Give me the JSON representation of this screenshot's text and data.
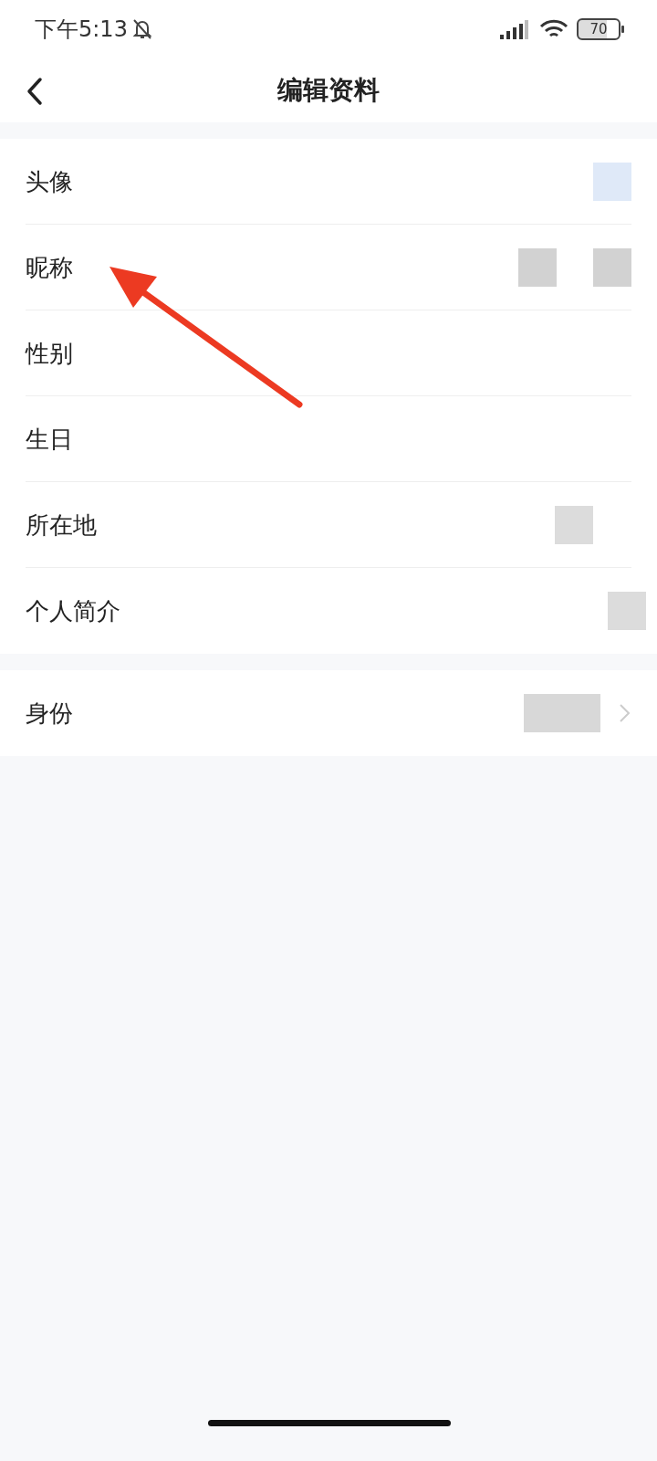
{
  "status_bar": {
    "time": "下午5:13",
    "battery": "70"
  },
  "header": {
    "title": "编辑资料"
  },
  "groups": [
    {
      "rows": [
        {
          "label": "头像",
          "kind": "avatar",
          "chevron": false
        },
        {
          "label": "昵称",
          "kind": "redacted-pair",
          "chevron": false
        },
        {
          "label": "性别",
          "kind": "none",
          "chevron": false
        },
        {
          "label": "生日",
          "kind": "none",
          "chevron": false
        },
        {
          "label": "所在地",
          "kind": "redacted",
          "chevron": false
        },
        {
          "label": "个人简介",
          "kind": "redacted-edge",
          "chevron": false
        }
      ]
    },
    {
      "rows": [
        {
          "label": "身份",
          "kind": "redacted-wide",
          "chevron": true
        }
      ]
    }
  ]
}
